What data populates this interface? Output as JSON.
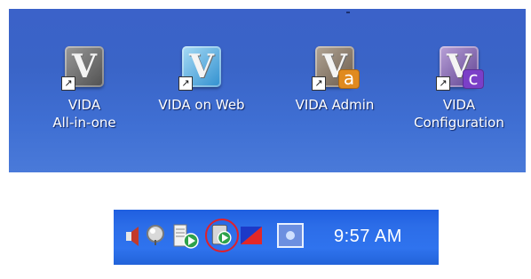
{
  "desktop": {
    "shortcuts": [
      {
        "label": "VIDA\nAll-in-one",
        "letter": "V",
        "badge": "",
        "tile_color": "#6f6f6f",
        "icon": "vida-allinone-icon"
      },
      {
        "label": "VIDA on Web",
        "letter": "V",
        "badge": "",
        "tile_color": "#59b6e6",
        "icon": "vida-web-icon"
      },
      {
        "label": "VIDA Admin",
        "letter": "V",
        "badge": "a",
        "tile_color": "#8a7b6a",
        "badge_color": "#e08a1f",
        "icon": "vida-admin-icon"
      },
      {
        "label": "VIDA\nConfiguration",
        "letter": "V",
        "badge": "c",
        "tile_color": "#7a5fa0",
        "badge_color": "#7b3fc8",
        "icon": "vida-config-icon"
      }
    ]
  },
  "taskbar": {
    "clock": "9:57 AM",
    "tray_icons": [
      "speaker-icon",
      "network-ball-icon",
      "files-play-icon",
      "vida-tray-icon",
      "flag-icon",
      "screen-icon"
    ]
  }
}
